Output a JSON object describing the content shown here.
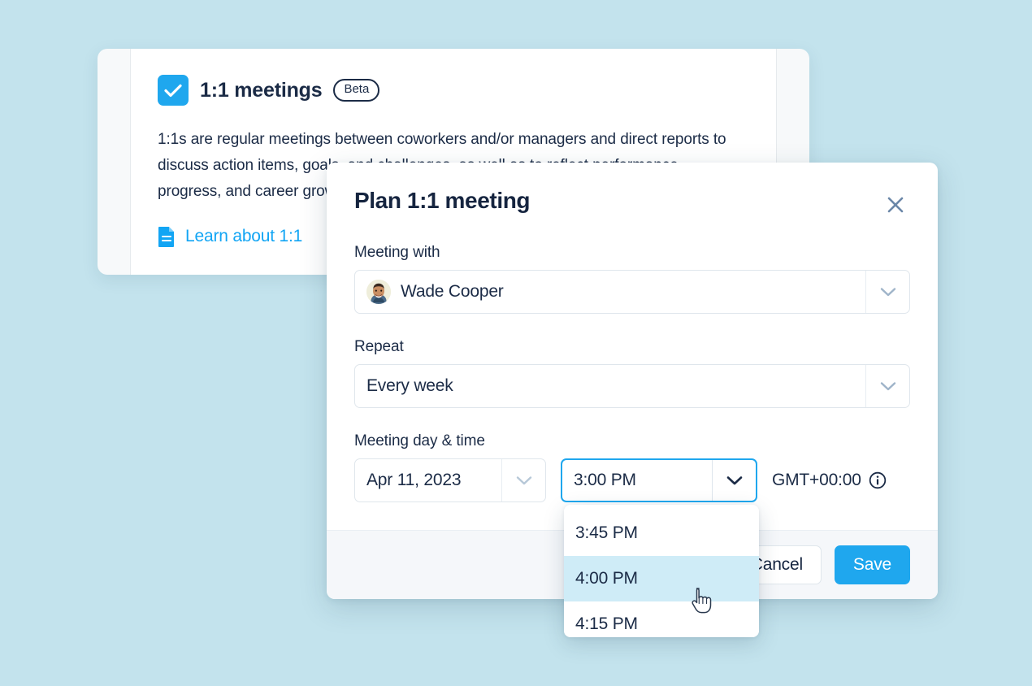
{
  "theme": {
    "page_bg": "#c3e3ed",
    "accent_blue": "#1fa7ee",
    "link_blue": "#12a5f4",
    "text_navy": "#1b2b46",
    "highlight_blue": "#cfecf7"
  },
  "feature_card": {
    "checkbox_checked": true,
    "checkbox_icon": "check-icon",
    "title": "1:1 meetings",
    "badge": "Beta",
    "description": "1:1s are regular meetings between coworkers and/or managers and direct reports to discuss action items, goals, and challenges, as well as to reflect performance, progress, and career growth.",
    "link": {
      "icon": "document-icon",
      "label": "Learn about 1:1"
    }
  },
  "modal": {
    "title": "Plan 1:1 meeting",
    "close_icon": "close-icon",
    "fields": {
      "meeting_with": {
        "label": "Meeting with",
        "value": "Wade Cooper",
        "avatar": "user-avatar",
        "caret_icon": "chevron-down-icon"
      },
      "repeat": {
        "label": "Repeat",
        "value": "Every week",
        "caret_icon": "chevron-down-icon"
      },
      "meeting_day_time": {
        "label": "Meeting day & time",
        "date_value": "Apr 11, 2023",
        "date_caret_icon": "chevron-down-icon",
        "time_value": "3:00 PM",
        "time_caret_icon": "chevron-down-icon",
        "timezone": "GMT+00:00",
        "timezone_info_icon": "info-icon"
      }
    },
    "footer": {
      "cancel_label": "Cancel",
      "save_label": "Save"
    }
  },
  "time_dropdown": {
    "options": [
      {
        "label": "3:45 PM",
        "highlighted": false
      },
      {
        "label": "4:00 PM",
        "highlighted": true
      },
      {
        "label": "4:15 PM",
        "highlighted": false
      }
    ],
    "cursor_icon": "pointer-cursor"
  }
}
